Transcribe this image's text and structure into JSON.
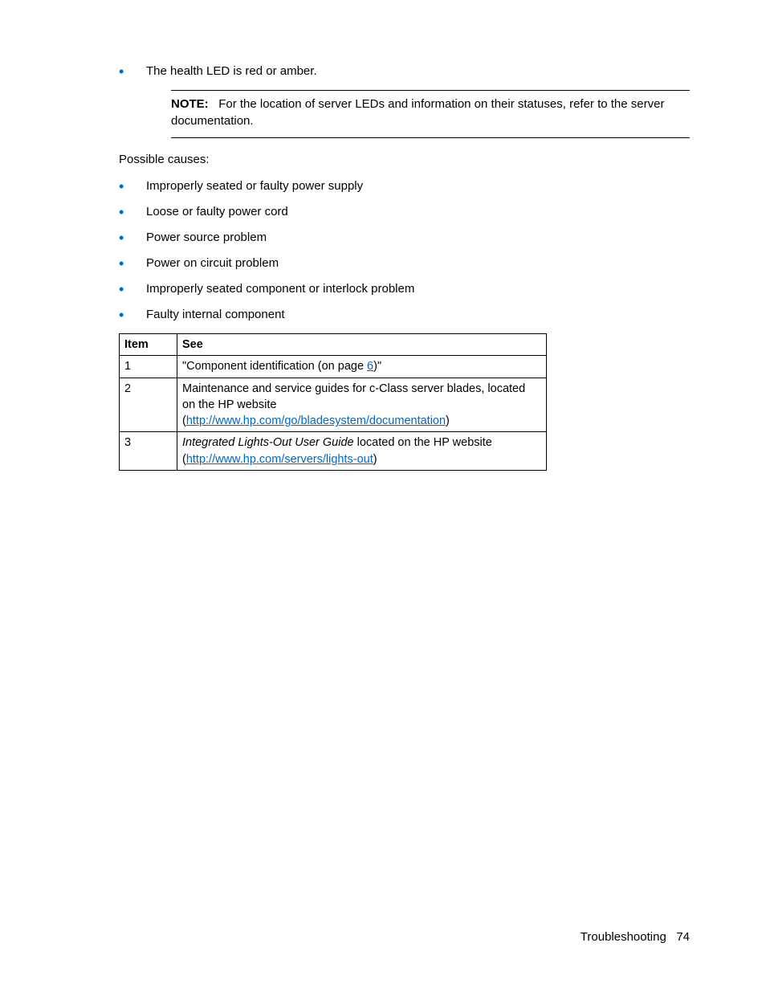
{
  "bullet_intro": "The health LED is red or amber.",
  "note": {
    "label": "NOTE:",
    "text": "For the location of server LEDs and information on their statuses, refer to the server documentation."
  },
  "causes_heading": "Possible causes:",
  "causes": {
    "c0": "Improperly seated or faulty power supply",
    "c1": "Loose or faulty power cord",
    "c2": "Power source problem",
    "c3": "Power on circuit problem",
    "c4": "Improperly seated component or interlock problem",
    "c5": "Faulty internal component"
  },
  "table": {
    "h1": "Item",
    "h2": "See",
    "r1_item": "1",
    "r1_a": "\"Component identification (on page ",
    "r1_link": "6",
    "r1_b": ")\"",
    "r2_item": "2",
    "r2_a": "Maintenance and service guides for c-Class server blades, located on the HP website (",
    "r2_link": "http://www.hp.com/go/bladesystem/documentation",
    "r2_b": ")",
    "r3_item": "3",
    "r3_ai": "Integrated Lights-Out User Guide",
    "r3_a": " located on the HP website (",
    "r3_link": "http://www.hp.com/servers/lights-out",
    "r3_b": ")"
  },
  "footer": {
    "section": "Troubleshooting",
    "page": "74"
  }
}
